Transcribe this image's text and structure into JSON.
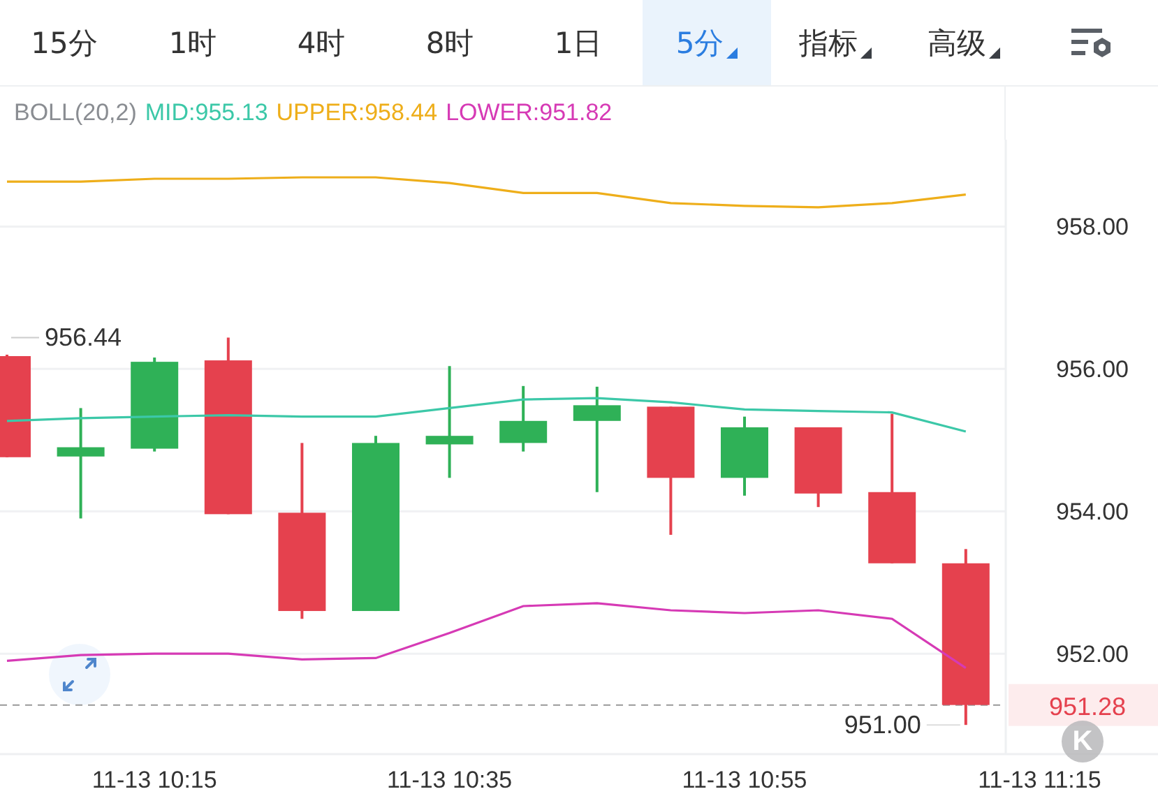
{
  "toolbar": {
    "tabs": [
      {
        "label": "15分",
        "selected": false,
        "dropdown": false
      },
      {
        "label": "1时",
        "selected": false,
        "dropdown": false
      },
      {
        "label": "4时",
        "selected": false,
        "dropdown": false
      },
      {
        "label": "8时",
        "selected": false,
        "dropdown": false
      },
      {
        "label": "1日",
        "selected": false,
        "dropdown": false
      },
      {
        "label": "5分",
        "selected": true,
        "dropdown": true
      },
      {
        "label": "指标",
        "selected": false,
        "dropdown": true
      },
      {
        "label": "高级",
        "selected": false,
        "dropdown": true
      }
    ]
  },
  "indicator_legend": {
    "name": "BOLL(20,2)",
    "items": [
      {
        "text": "MID:955.13",
        "color": "#3cc8a8"
      },
      {
        "text": "UPPER:958.44",
        "color": "#eeae1a"
      },
      {
        "text": "LOWER:951.82",
        "color": "#d63ab5"
      }
    ]
  },
  "chart": {
    "chart_data": {
      "type": "line",
      "categories": [
        null,
        null,
        "11-13 10:15",
        null,
        null,
        null,
        "11-13 10:35",
        null,
        null,
        null,
        "11-13 10:55",
        null,
        null,
        null,
        "11-13 11:15"
      ],
      "ylim": [
        950.59,
        959.22
      ],
      "yticks": [
        {
          "value": 958,
          "label": "958.00"
        },
        {
          "value": 956,
          "label": "956.00"
        },
        {
          "value": 954,
          "label": "954.00"
        },
        {
          "value": 952,
          "label": "952.00"
        }
      ],
      "series": [
        {
          "color": "#eeae1a",
          "values": [
            958.63,
            958.63,
            958.67,
            958.67,
            958.69,
            958.69,
            958.61,
            958.47,
            958.47,
            958.33,
            958.29,
            958.27,
            958.33,
            958.45,
            null
          ]
        },
        {
          "color": "#3cc8a8",
          "values": [
            955.27,
            955.31,
            955.33,
            955.35,
            955.33,
            955.33,
            955.45,
            955.57,
            955.59,
            955.53,
            955.43,
            955.41,
            955.39,
            955.12,
            null
          ]
        },
        {
          "color": "#d63ab5",
          "values": [
            951.9,
            951.98,
            952.0,
            952.0,
            951.92,
            951.94,
            952.29,
            952.67,
            952.71,
            952.61,
            952.57,
            952.61,
            952.49,
            951.8,
            null
          ]
        }
      ],
      "grid": true,
      "annotations": [
        "956.44",
        "951.00"
      ],
      "ref_lines": [
        {
          "axis": "y",
          "value": 951.28,
          "label": "951.28"
        }
      ]
    },
    "candles": [
      {
        "color": "#e5414e"
      },
      {
        "color": "#2fb157"
      },
      {
        "color": "#2fb157"
      },
      {
        "color": "#e5414e"
      },
      {
        "color": "#e5414e"
      },
      {
        "color": "#2fb157"
      },
      {
        "color": "#2fb157"
      },
      {
        "color": "#2fb157"
      },
      {
        "color": "#2fb157"
      },
      {
        "color": "#e5414e"
      },
      {
        "color": "#2fb157"
      },
      {
        "color": "#e5414e"
      },
      {
        "color": "#e5414e"
      },
      {
        "color": "#e5414e"
      }
    ],
    "k_button": {
      "label": "K"
    }
  }
}
